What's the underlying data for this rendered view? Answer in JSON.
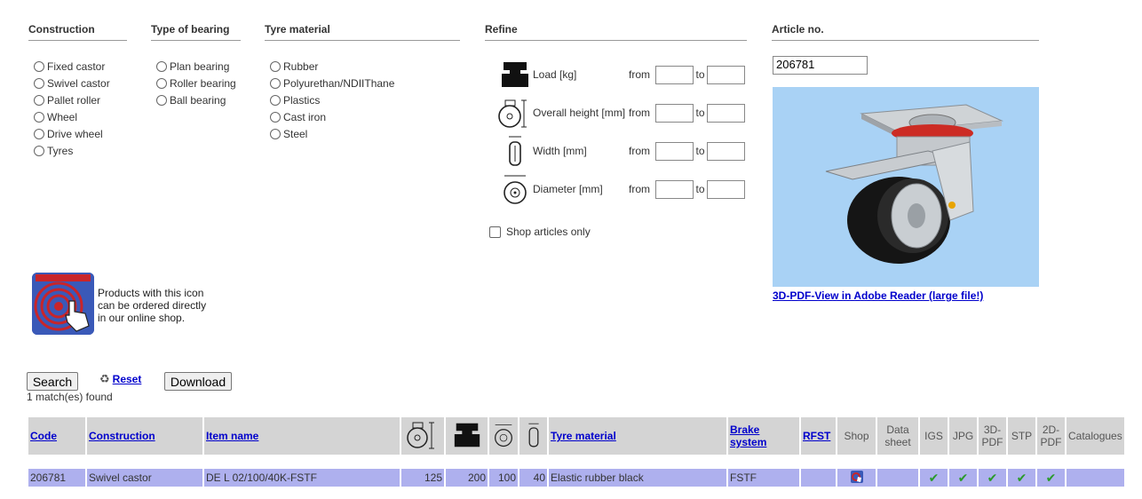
{
  "filters": {
    "construction": {
      "title": "Construction",
      "options": [
        "Fixed castor",
        "Swivel castor",
        "Pallet roller",
        "Wheel",
        "Drive wheel",
        "Tyres"
      ]
    },
    "bearing": {
      "title": "Type of bearing",
      "options": [
        "Plan bearing",
        "Roller bearing",
        "Ball bearing"
      ]
    },
    "tyre": {
      "title": "Tyre material",
      "options": [
        "Rubber",
        "Polyurethan/NDIIThane",
        "Plastics",
        "Cast iron",
        "Steel"
      ]
    }
  },
  "refine": {
    "title": "Refine",
    "from_label": "from",
    "to_label": "to",
    "rows": [
      {
        "label": "Load [kg]",
        "icon": "load-icon"
      },
      {
        "label": "Overall height [mm]",
        "icon": "height-icon"
      },
      {
        "label": "Width [mm]",
        "icon": "width-icon"
      },
      {
        "label": "Diameter [mm]",
        "icon": "diameter-icon"
      }
    ],
    "shop_only_label": "Shop articles only"
  },
  "article": {
    "title": "Article no.",
    "value": "206781",
    "pdf_link": "3D-PDF-View in Adobe Reader (large file!)"
  },
  "shop_info": {
    "text_lines": [
      "Products with this icon",
      "can be ordered directly",
      "in our online shop."
    ],
    "icon": "shop-hand-icon"
  },
  "actions": {
    "search": "Search",
    "reset": "Reset",
    "download": "Download",
    "match_count": "1 match(es) found"
  },
  "table": {
    "headers": {
      "code": "Code",
      "construction": "Construction",
      "item_name": "Item name",
      "tyre_material": "Tyre material",
      "brake_system": "Brake system",
      "rfst": "RFST",
      "shop": "Shop",
      "data_sheet": "Data sheet",
      "igs": "IGS",
      "jpg": "JPG",
      "pdf3d": "3D-PDF",
      "stp": "STP",
      "pdf2d": "2D-PDF",
      "catalogues": "Catalogues"
    },
    "rows": [
      {
        "code": "206781",
        "construction": "Swivel castor",
        "item_name": "DE L 02/100/40K-FSTF",
        "height": "125",
        "load": "200",
        "diameter": "100",
        "width": "40",
        "tyre_material": "Elastic rubber black",
        "brake_system": "FSTF",
        "rfst": "",
        "shop_icon": "shop-cart-icon",
        "check_icon": "check-icon"
      }
    ]
  },
  "colors": {
    "row_bg": "#aeb0ee",
    "header_bg": "#d4d4d4",
    "link": "#0000cc",
    "image_bg": "#a9d2f5"
  }
}
